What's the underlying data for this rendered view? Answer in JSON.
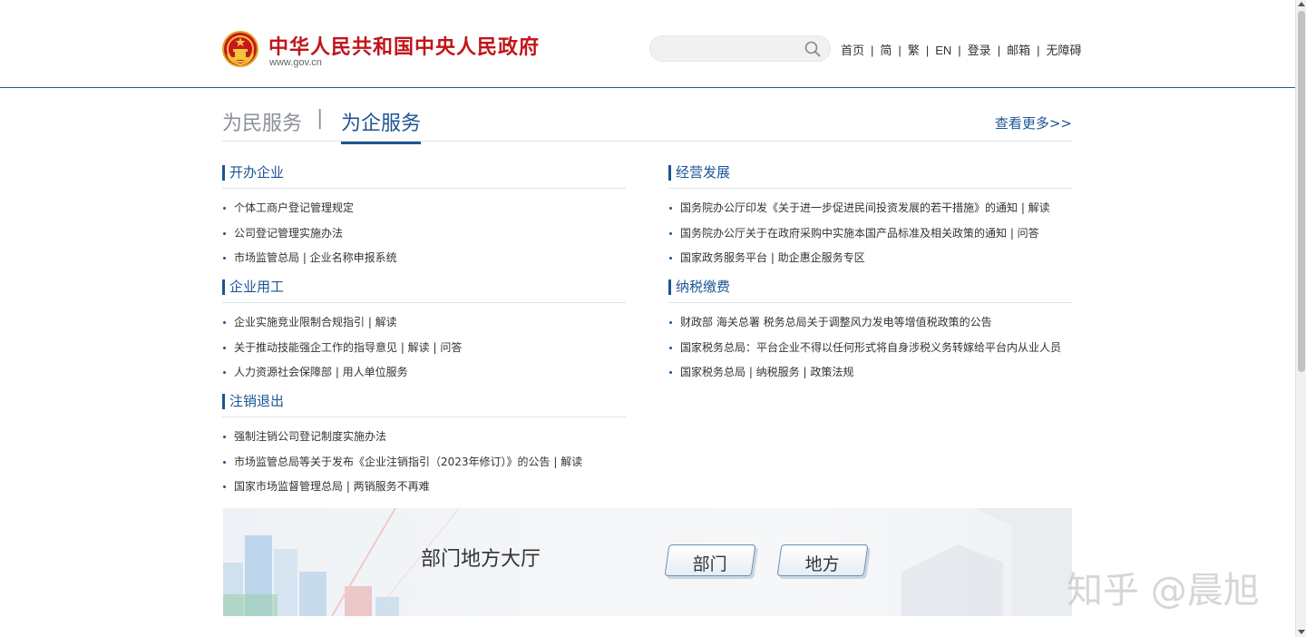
{
  "header": {
    "site_title": "中华人民共和国中央人民政府",
    "site_url": "www.gov.cn",
    "search_placeholder": "",
    "nav": [
      "首页",
      "简",
      "繁",
      "EN",
      "登录",
      "邮箱",
      "无障碍"
    ],
    "nav_separator": "|"
  },
  "tabs": {
    "items": [
      "为民服务",
      "为企服务"
    ],
    "separator": "|",
    "active": "为企服务",
    "more": "查看更多>>"
  },
  "sections": [
    {
      "title": "开办企业",
      "items": [
        "个体工商户登记管理规定",
        "公司登记管理实施办法",
        "市场监管总局 | 企业名称申报系统"
      ]
    },
    {
      "title": "企业用工",
      "items": [
        "企业实施竞业限制合规指引 | 解读",
        "关于推动技能强企工作的指导意见 | 解读 | 问答",
        "人力资源社会保障部 | 用人单位服务"
      ]
    },
    {
      "title": "注销退出",
      "items": [
        "强制注销公司登记制度实施办法",
        "市场监管总局等关于发布《企业注销指引（2023年修订）》的公告 | 解读",
        "国家市场监督管理总局 | 两销服务不再难"
      ]
    },
    {
      "title": "经营发展",
      "items": [
        "国务院办公厅印发《关于进一步促进民间投资发展的若干措施》的通知 | 解读",
        "国务院办公厅关于在政府采购中实施本国产品标准及相关政策的通知 | 问答",
        "国家政务服务平台 | 助企惠企服务专区"
      ]
    },
    {
      "title": "纳税缴费",
      "items": [
        "财政部 海关总署 税务总局关于调整风力发电等增值税政策的公告",
        "国家税务总局：平台企业不得以任何形式将自身涉税义务转嫁给平台内从业人员",
        "国家税务总局 | 纳税服务 | 政策法规"
      ]
    }
  ],
  "banner": {
    "title": "部门地方大厅",
    "buttons": [
      "部门",
      "地方"
    ]
  },
  "watermark": "知乎 @晨旭",
  "colors": {
    "brand_red": "#c0151b",
    "link_blue": "#1c5595",
    "muted_gray": "#8b9097"
  }
}
